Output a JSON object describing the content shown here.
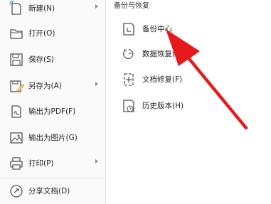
{
  "file_menu": {
    "items": [
      {
        "label": "新建(N)",
        "icon": "new-file-icon",
        "has_submenu": true
      },
      {
        "label": "打开(O)",
        "icon": "folder-open-icon",
        "has_submenu": false
      },
      {
        "label": "保存(S)",
        "icon": "save-icon",
        "has_submenu": false
      },
      {
        "label": "另存为(A)",
        "icon": "save-as-icon",
        "has_submenu": true
      },
      {
        "label": "输出为PDF(F)",
        "icon": "export-pdf-icon",
        "has_submenu": false
      },
      {
        "label": "输出为图片(G)",
        "icon": "export-image-icon",
        "has_submenu": false
      },
      {
        "label": "打印(P)",
        "icon": "printer-icon",
        "has_submenu": true
      },
      {
        "label": "分享文档(D)",
        "icon": "share-icon",
        "has_submenu": false
      }
    ]
  },
  "backup_panel": {
    "title": "备份与恢复",
    "items": [
      {
        "label": "备份中心",
        "icon": "backup-center-icon"
      },
      {
        "label": "数据恢复(R)",
        "icon": "data-recovery-icon"
      },
      {
        "label": "文档修复(F)",
        "icon": "document-repair-icon"
      },
      {
        "label": "历史版本(H)",
        "icon": "history-version-icon"
      }
    ]
  },
  "annotation": {
    "color": "#e8191c",
    "points_to": "备份中心"
  },
  "colors": {
    "menu_bg": "#fafafa",
    "text": "#262626",
    "icon_stroke": "#555555",
    "arrow": "#8a8a8a"
  }
}
